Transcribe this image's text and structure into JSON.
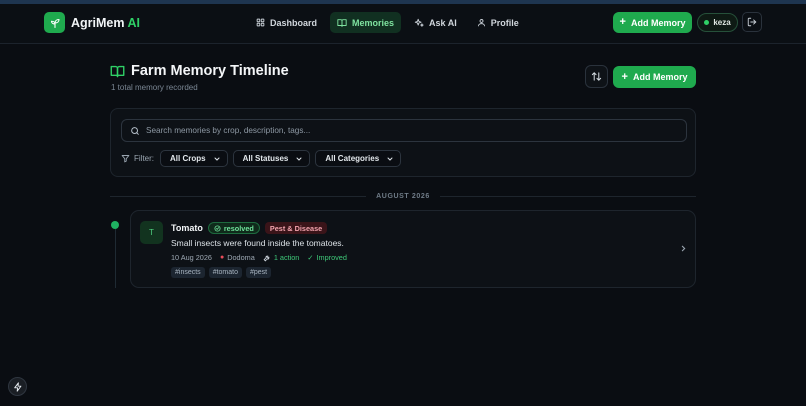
{
  "app": {
    "name_main": "AgriMem",
    "name_accent": "AI"
  },
  "nav": [
    {
      "label": "Dashboard",
      "icon": "grid-icon"
    },
    {
      "label": "Memories",
      "icon": "book-icon",
      "active": true
    },
    {
      "label": "Ask AI",
      "icon": "sparkle-icon"
    },
    {
      "label": "Profile",
      "icon": "user-icon"
    }
  ],
  "header": {
    "add_label": "Add Memory",
    "user": "keza"
  },
  "page": {
    "title": "Farm Memory Timeline",
    "subtitle": "1 total memory recorded",
    "add_label": "Add Memory"
  },
  "search": {
    "placeholder": "Search memories by crop, description, tags...",
    "value": ""
  },
  "filters": {
    "label": "Filter:",
    "crops": "All Crops",
    "statuses": "All Statuses",
    "categories": "All Categories"
  },
  "month_label": "AUGUST 2026",
  "memory": {
    "initial": "T",
    "crop": "Tomato",
    "status": "resolved",
    "category": "Pest & Disease",
    "description": "Small insects were found inside the tomatoes.",
    "date": "10 Aug 2026",
    "location": "Dodoma",
    "actions": "1 action",
    "outcome": "Improved",
    "tags": [
      "#insects",
      "#tomato",
      "#pest"
    ]
  },
  "colors": {
    "accent": "#1faa4e",
    "background": "#0a0d12",
    "danger_badge": "#3a1419"
  }
}
